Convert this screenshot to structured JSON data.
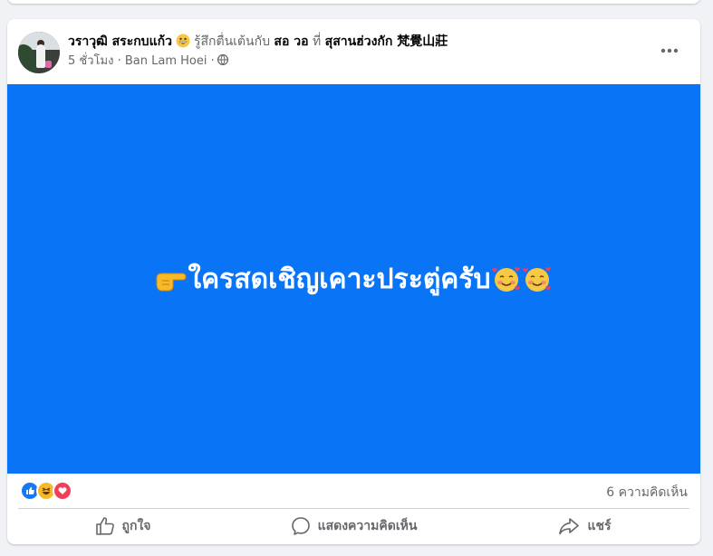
{
  "post": {
    "author": "วราวุฒิ สระกบแก้ว",
    "feeling_text": "รู้สึกตื่นเต้นกับ",
    "tagged_person": "สอ วอ",
    "at_word": "ที่",
    "place": "สุสานฮ่วงกัก 梵覺山莊",
    "time": "5 ชั่วโมง",
    "location": "Ban Lam Hoei",
    "separator": "·",
    "status_text": "ใครสดเชิญเคาะประตู่ครับ",
    "background_color": "#0a74f7",
    "comment_count": "6 ความคิดเห็น",
    "reaction_icons": [
      "like-icon",
      "haha-icon",
      "love-icon"
    ]
  },
  "actions": {
    "like_label": "ถูกใจ",
    "comment_label": "แสดงความคิดเห็น",
    "share_label": "แชร์"
  },
  "colors": {
    "like_blue": "#1877f2",
    "love_red": "#f33e58",
    "haha_yellow": "#f7b928",
    "muted_text": "#65676b"
  }
}
